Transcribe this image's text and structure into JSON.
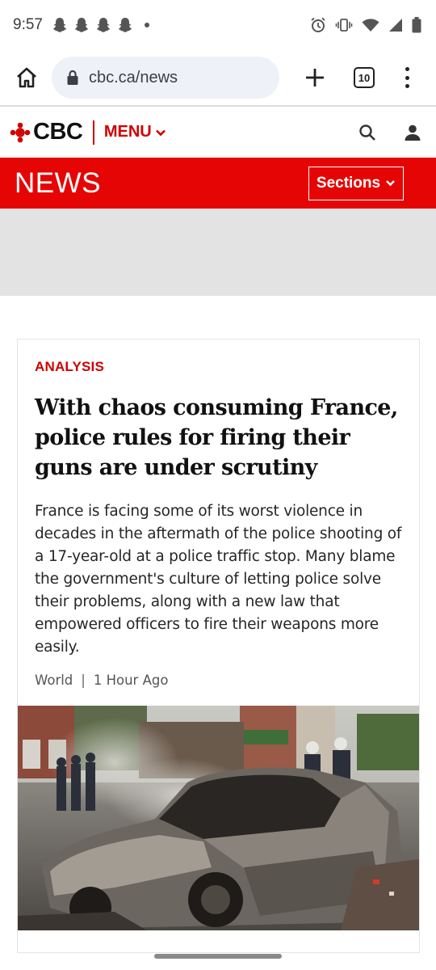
{
  "status": {
    "time": "9:57",
    "notification_icons": [
      "snapchat-icon",
      "snapchat-icon",
      "snapchat-icon",
      "snapchat-icon",
      "more-dot-icon"
    ],
    "system_icons": [
      "alarm-icon",
      "vibrate-icon",
      "wifi-icon",
      "signal-icon",
      "battery-icon"
    ]
  },
  "browser": {
    "url": "cbc.ca/news",
    "tab_count": "10"
  },
  "header": {
    "logo_text": "CBC",
    "menu_label": "MENU"
  },
  "newsbar": {
    "title": "NEWS",
    "sections_label": "Sections"
  },
  "story": {
    "kicker": "ANALYSIS",
    "headline": "With chaos consuming France, police rules for firing their guns are under scrutiny",
    "summary": "France is facing some of its worst violence in decades in the aftermath of the police shooting of a 17-year-old at a police traffic stop. Many blame the government's culture of letting police solve their problems, along with a new law that empowered officers to fire their weapons more easily.",
    "category": "World",
    "meta_separator": "|",
    "time_ago": "1 Hour Ago"
  },
  "colors": {
    "brand_red": "#e60505",
    "text_red": "#d00000",
    "url_pill": "#eef1f7",
    "ad_gray": "#e3e3e3"
  }
}
